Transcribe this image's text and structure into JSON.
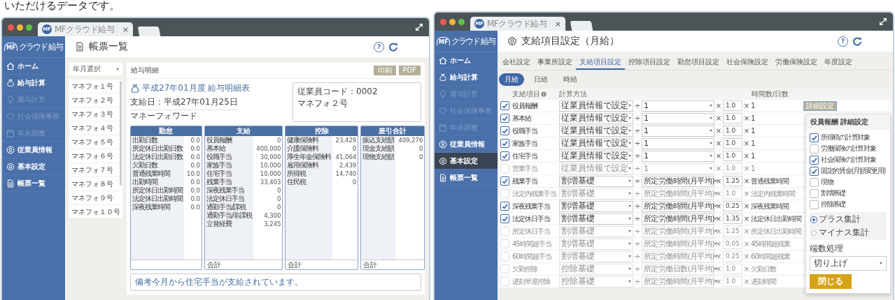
{
  "caption": "いただけるデータです。",
  "left_window": {
    "tab": {
      "badge": "MF",
      "title": "MFクラウド給与",
      "close": "×"
    },
    "logo": {
      "mark": "MF",
      "text": "クラウド 給与"
    },
    "sidebar": [
      {
        "kind": "home",
        "label": "ホーム",
        "disabled": false,
        "selected": false
      },
      {
        "kind": "bag",
        "label": "給与計算",
        "disabled": false,
        "selected": false
      },
      {
        "kind": "bulb",
        "label": "賞与計算",
        "disabled": true,
        "selected": false
      },
      {
        "kind": "heart",
        "label": "社会保険事務",
        "disabled": true,
        "selected": false
      },
      {
        "kind": "calendar",
        "label": "年末調整",
        "disabled": true,
        "selected": false
      },
      {
        "kind": "person",
        "label": "従業員情報",
        "disabled": false,
        "selected": false
      },
      {
        "kind": "gear",
        "label": "基本設定",
        "disabled": false,
        "selected": false
      },
      {
        "kind": "doc",
        "label": "帳票一覧",
        "disabled": false,
        "selected": false
      }
    ],
    "header": {
      "title": "帳票一覧",
      "help": "?"
    },
    "month_select": {
      "placeholder": "年月選択"
    },
    "employees": [
      "マネフォ１号",
      "マネフォ２号",
      "マネフォ３号",
      "マネフォ４号",
      "マネフォ５号",
      "マネフォ６号",
      "マネフォ７号",
      "マネフォ８号",
      "マネフォ９号",
      "マネフォ１０号"
    ],
    "payslip": {
      "heading": "給与明細",
      "buttons": [
        "印刷",
        "PDF"
      ],
      "title": "平成27年01月度 給与明細表",
      "pay_date": "支給日：平成27年01月25日",
      "company": "マネーフォワード",
      "employee_code": "従業員コード：0002",
      "employee_name": "マネフォ２号",
      "columns": [
        {
          "title": "勤怠",
          "rows": [
            {
              "label": "出勤日数",
              "value": "0.0"
            },
            {
              "label": "所定休日出勤日数",
              "value": "0.0"
            },
            {
              "label": "法定休日出勤日数",
              "value": "0.0"
            },
            {
              "label": "欠勤日数",
              "value": "0.0"
            },
            {
              "label": "普通残業時間",
              "value": "10.0"
            },
            {
              "label": "出勤時間",
              "value": "0.0"
            },
            {
              "label": "所定休日出勤時間",
              "value": "0.0"
            },
            {
              "label": "法定休日出勤時間",
              "value": "0.0"
            },
            {
              "label": "深夜残業時間",
              "value": "0.0"
            }
          ]
        },
        {
          "title": "支給",
          "total": "合計",
          "rows": [
            {
              "label": "役員報酬",
              "value": "0"
            },
            {
              "label": "基本給",
              "value": "400,000"
            },
            {
              "label": "役職手当",
              "value": "30,000"
            },
            {
              "label": "家族手当",
              "value": "10,000"
            },
            {
              "label": "住宅手当",
              "value": "10,000"
            },
            {
              "label": "残業手当",
              "value": "33,403"
            },
            {
              "label": "深夜残業手当",
              "value": "0"
            },
            {
              "label": "法定休日手当",
              "value": "0"
            },
            {
              "label": "通勤手当/課税",
              "value": "0"
            },
            {
              "label": "通勤手当/非課税",
              "value": "4,300"
            },
            {
              "label": "立替経費",
              "value": "3,245"
            }
          ]
        },
        {
          "title": "控除",
          "total": "合計",
          "rows": [
            {
              "label": "健康保険料",
              "value": "23,429"
            },
            {
              "label": "介護保険料",
              "value": "0"
            },
            {
              "label": "厚生年金保険料",
              "value": "41,064"
            },
            {
              "label": "雇用保険料",
              "value": "2,439"
            },
            {
              "label": "所得税",
              "value": "14,740"
            },
            {
              "label": "住民税",
              "value": "0"
            }
          ]
        },
        {
          "title": "差引合計",
          "total": "合計",
          "rows": [
            {
              "label": "振込支給額",
              "value": "409,276"
            },
            {
              "label": "現金支給額",
              "value": "0"
            },
            {
              "label": "現物支給額",
              "value": "0"
            }
          ]
        }
      ],
      "remark": "備考今月から住宅手当が支給されています。"
    }
  },
  "right_window": {
    "tab": {
      "badge": "MF",
      "title": "MFクラウド給与",
      "close": "×"
    },
    "logo": {
      "mark": "MF",
      "text": "クラウド 給与"
    },
    "sidebar": [
      {
        "kind": "home",
        "label": "ホーム",
        "disabled": false,
        "selected": false
      },
      {
        "kind": "bag",
        "label": "給与計算",
        "disabled": false,
        "selected": false
      },
      {
        "kind": "bulb",
        "label": "賞与計算",
        "disabled": true,
        "selected": false
      },
      {
        "kind": "heart",
        "label": "社会保険事務",
        "disabled": true,
        "selected": false
      },
      {
        "kind": "calendar",
        "label": "年末調整",
        "disabled": true,
        "selected": false
      },
      {
        "kind": "person",
        "label": "従業員情報",
        "disabled": false,
        "selected": false
      },
      {
        "kind": "gear",
        "label": "基本設定",
        "disabled": false,
        "selected": true
      },
      {
        "kind": "doc",
        "label": "帳票一覧",
        "disabled": false,
        "selected": false
      }
    ],
    "header": {
      "title": "支給項目設定（月給）",
      "help": "?"
    },
    "tabs": [
      {
        "label": "会社設定",
        "selected": false
      },
      {
        "label": "事業所設定",
        "selected": false
      },
      {
        "label": "支給項目設定",
        "selected": true
      },
      {
        "label": "控除項目設定",
        "selected": false
      },
      {
        "label": "勤怠項目設定",
        "selected": false
      },
      {
        "label": "社会保険設定",
        "selected": false
      },
      {
        "label": "労働保険設定",
        "selected": false
      },
      {
        "label": "年度設定",
        "selected": false
      }
    ],
    "pay_types": [
      {
        "label": "月給",
        "selected": true
      },
      {
        "label": "日給",
        "selected": false
      },
      {
        "label": "時給",
        "selected": false
      }
    ],
    "table": {
      "columns": [
        "支給項目",
        "計算方法",
        "時間数/日数"
      ],
      "rows": [
        {
          "checked": true,
          "name": "役員報酬",
          "method": "従業員情報で設定",
          "op1": "÷",
          "divisor": "1",
          "op2": "×",
          "factor": "1.0",
          "op3": "×",
          "unit": "1",
          "detail_button": "詳細設定"
        },
        {
          "checked": true,
          "name": "基本給",
          "method": "従業員情報で設定",
          "op1": "÷",
          "divisor": "1",
          "op2": "×",
          "factor": "1.0",
          "op3": "×",
          "unit": "1"
        },
        {
          "checked": true,
          "name": "役職手当",
          "method": "従業員情報で設定",
          "op1": "÷",
          "divisor": "1",
          "op2": "×",
          "factor": "1.0",
          "op3": "×",
          "unit": "1"
        },
        {
          "checked": true,
          "name": "家族手当",
          "method": "従業員情報で設定",
          "op1": "÷",
          "divisor": "1",
          "op2": "×",
          "factor": "1.0",
          "op3": "×",
          "unit": "1"
        },
        {
          "checked": true,
          "name": "住宅手当",
          "method": "従業員情報で設定",
          "op1": "÷",
          "divisor": "1",
          "op2": "×",
          "factor": "1.0",
          "op3": "×",
          "unit": "1"
        },
        {
          "checked": false,
          "name": "営業手当",
          "method": "従業員情報で設定",
          "op1": "÷",
          "divisor": "1",
          "op2": "×",
          "factor": "1.0",
          "op3": "×",
          "unit": "1"
        },
        {
          "checked": true,
          "name": "残業手当",
          "method": "割増基礎",
          "op1": "÷",
          "divisor": "所定労働時間(月平均)",
          "op2": "×",
          "factor": "1.25",
          "op3": "×",
          "unit": "普通残業時間"
        },
        {
          "checked": false,
          "name": "法定内残業手当",
          "method": "割増基礎",
          "op1": "÷",
          "divisor": "所定労働時間(月平均)",
          "op2": "×",
          "factor": "1.0",
          "op3": "×",
          "unit": "法定内残業時間"
        },
        {
          "checked": true,
          "name": "深夜残業手当",
          "method": "割増基礎",
          "op1": "÷",
          "divisor": "所定労働時間(月平均)",
          "op2": "×",
          "factor": "0.25",
          "op3": "×",
          "unit": "深夜残業時間"
        },
        {
          "checked": true,
          "name": "法定休日手当",
          "method": "割増基礎",
          "op1": "÷",
          "divisor": "所定労働時間(月平均)",
          "op2": "×",
          "factor": "1.35",
          "op3": "×",
          "unit": "法定休日出勤時間"
        },
        {
          "checked": false,
          "name": "所定休日手当",
          "method": "割増基礎",
          "op1": "÷",
          "divisor": "所定労働時間(月平均)",
          "op2": "×",
          "factor": "1.25",
          "op3": "×",
          "unit": "所定休日出勤時間"
        },
        {
          "checked": false,
          "name": "45時間超手当",
          "method": "割増基礎",
          "op1": "÷",
          "divisor": "所定労働時間(月平均)",
          "op2": "×",
          "factor": "0.05",
          "op3": "×",
          "unit": "45時間超残業"
        },
        {
          "checked": false,
          "name": "60時間超手当",
          "method": "割増基礎",
          "op1": "÷",
          "divisor": "所定労働時間(月平均)",
          "op2": "×",
          "factor": "0.25",
          "op3": "×",
          "unit": "60時間超残業"
        },
        {
          "checked": false,
          "name": "欠勤控除",
          "method": "控除基礎",
          "op1": "÷",
          "divisor": "所定労働日数(月平均)",
          "op2": "×",
          "factor": "1.0",
          "op3": "×",
          "unit": "欠勤日数"
        },
        {
          "checked": false,
          "name": "遅刻早退控除",
          "method": "控除基礎",
          "op1": "÷",
          "divisor": "所定労働時間(月平均)",
          "op2": "×",
          "factor": "1.0",
          "op3": "×",
          "unit": "遅刻時間"
        }
      ]
    },
    "popup": {
      "title": "役員報酬 詳細設定",
      "options": [
        {
          "label": "所得税の計算対象",
          "checked": true
        },
        {
          "label": "労働保険の計算対象",
          "checked": false
        },
        {
          "label": "社会保険の計算対象",
          "checked": true
        },
        {
          "label": "固定的賃金(月額変更用)",
          "checked": true
        },
        {
          "label": "現物",
          "checked": false
        },
        {
          "label": "割増基礎",
          "checked": false
        },
        {
          "label": "控除基礎",
          "checked": false
        }
      ],
      "aggregation": [
        {
          "label": "プラス集計",
          "selected": true
        },
        {
          "label": "マイナス集計",
          "selected": false
        }
      ],
      "rounding_label": "端数処理",
      "rounding": "切り上げ",
      "close_button": "閉じる"
    }
  }
}
